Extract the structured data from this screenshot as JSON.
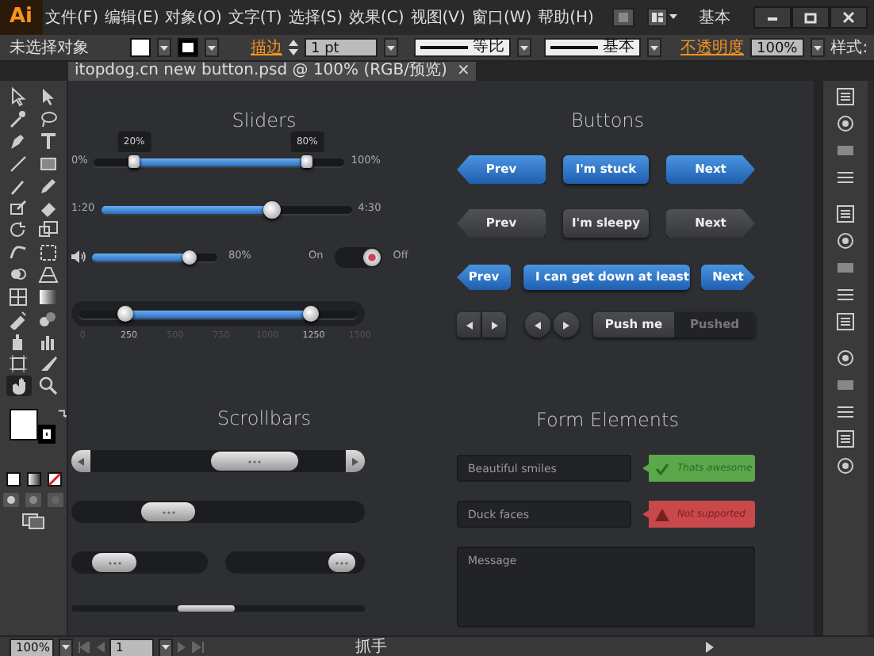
{
  "app": {
    "logo": "Ai",
    "menus": [
      "文件(F)",
      "编辑(E)",
      "对象(O)",
      "文字(T)",
      "选择(S)",
      "效果(C)",
      "视图(V)",
      "窗口(W)",
      "帮助(H)"
    ],
    "workspace": "基本"
  },
  "control_bar": {
    "selection": "未选择对象",
    "stroke_label": "描边",
    "stroke_weight": "1 pt",
    "profile": "等比",
    "brush": "基本",
    "opacity_label": "不透明度",
    "opacity": "100%",
    "style_label": "样式:"
  },
  "document_tab": {
    "title": "itopdog.cn new button.psd @ 100% (RGB/预览)",
    "close": "×"
  },
  "tools": [
    {
      "kind": "pointer",
      "selected": false
    },
    {
      "kind": "direct",
      "selected": false
    },
    {
      "kind": "wand",
      "selected": false
    },
    {
      "kind": "lasso",
      "selected": false
    },
    {
      "kind": "pen",
      "selected": false
    },
    {
      "kind": "type",
      "selected": false
    },
    {
      "kind": "line",
      "selected": false
    },
    {
      "kind": "rect",
      "selected": false
    },
    {
      "kind": "brush",
      "selected": false
    },
    {
      "kind": "pencil",
      "selected": false
    },
    {
      "kind": "blob",
      "selected": false
    },
    {
      "kind": "eraser",
      "selected": false
    },
    {
      "kind": "rotate",
      "selected": false
    },
    {
      "kind": "scale",
      "selected": false
    },
    {
      "kind": "warp",
      "selected": false
    },
    {
      "kind": "transform",
      "selected": false
    },
    {
      "kind": "builder",
      "selected": false
    },
    {
      "kind": "grid",
      "selected": false
    },
    {
      "kind": "mesh",
      "selected": false
    },
    {
      "kind": "gradient",
      "selected": false
    },
    {
      "kind": "dropper",
      "selected": false
    },
    {
      "kind": "blend",
      "selected": false
    },
    {
      "kind": "spray",
      "selected": false
    },
    {
      "kind": "graph",
      "selected": false
    },
    {
      "kind": "artboard",
      "selected": false
    },
    {
      "kind": "knife",
      "selected": false
    },
    {
      "kind": "hand",
      "selected": true
    },
    {
      "kind": "zoom",
      "selected": false
    }
  ],
  "sliders": {
    "title": "Sliders",
    "range": {
      "min_label": "0%",
      "max_label": "100%",
      "thumbs": [
        {
          "tip": "20%",
          "level": 0.16
        },
        {
          "tip": "80%",
          "level": 0.85
        }
      ]
    },
    "time": {
      "start": "1:20",
      "end": "4:30",
      "level": 0.68
    },
    "volume": {
      "level": 0.78,
      "reading": "80%"
    },
    "toggle": {
      "on_label": "On",
      "off_label": "Off",
      "on": true
    },
    "scale": {
      "thumbs": [
        {
          "level": 0.1667
        },
        {
          "level": 0.8333
        }
      ],
      "ticks": [
        {
          "label": "0",
          "selected": false
        },
        {
          "label": "250",
          "selected": true
        },
        {
          "label": "500",
          "selected": false
        },
        {
          "label": "750",
          "selected": false
        },
        {
          "label": "1000",
          "selected": false
        },
        {
          "label": "1250",
          "selected": true
        },
        {
          "label": "1500",
          "selected": false
        }
      ]
    }
  },
  "buttons": {
    "title": "Buttons",
    "rows": [
      [
        {
          "kind": "prev",
          "label": "Prev"
        },
        {
          "kind": "plain",
          "label": "I'm stuck"
        },
        {
          "kind": "next",
          "label": "Next"
        }
      ],
      [
        {
          "kind": "prev",
          "label": "Prev"
        },
        {
          "kind": "plain",
          "label": "I'm sleepy"
        },
        {
          "kind": "next",
          "label": "Next"
        }
      ],
      [
        {
          "kind": "prev",
          "label": "Prev"
        },
        {
          "kind": "dropdown",
          "label": "I can get down at least"
        },
        {
          "kind": "next",
          "label": "Next"
        }
      ]
    ],
    "segmented": [
      {
        "label": "Push me",
        "selected": false
      },
      {
        "label": "Pushed",
        "selected": true
      }
    ]
  },
  "scrollbars": {
    "title": "Scrollbars",
    "bars": [
      {
        "kind": "arrows"
      },
      {
        "kind": "plain"
      },
      {
        "kind": "half"
      },
      {
        "kind": "thin"
      }
    ]
  },
  "form": {
    "title": "Form Elements",
    "fields": [
      {
        "placeholder": "Beautiful smiles",
        "kind": "success",
        "message": "Thats awesome"
      },
      {
        "placeholder": "Duck faces",
        "kind": "error",
        "message": "Not supported"
      }
    ],
    "textarea": {
      "placeholder": "Message"
    }
  },
  "status_bar": {
    "zoom": "100%",
    "page": "1",
    "tool": "抓手"
  }
}
